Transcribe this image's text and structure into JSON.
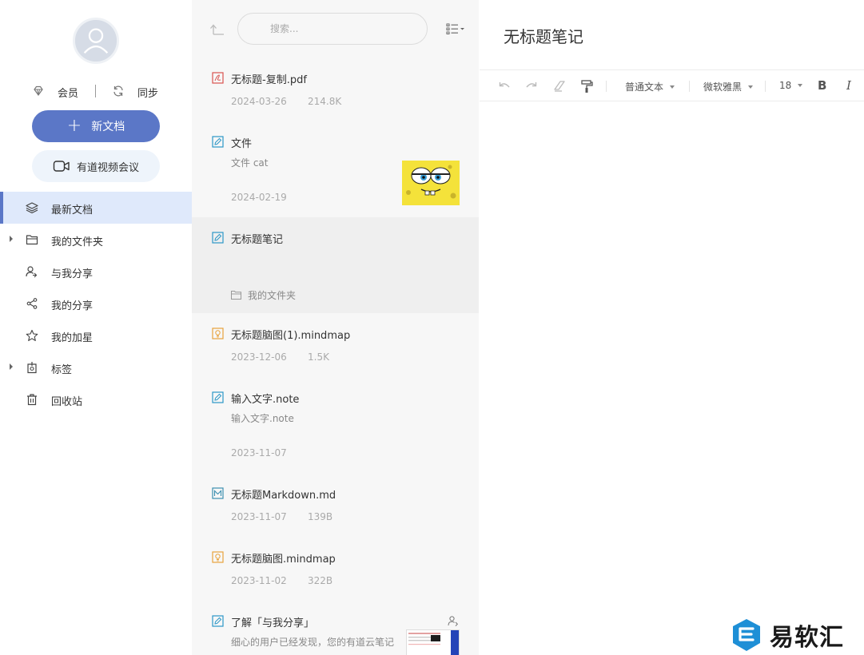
{
  "sidebar": {
    "vip_label": "会员",
    "sync_label": "同步",
    "new_doc_label": "新文档",
    "meeting_label": "有道视频会议",
    "nav": [
      {
        "label": "最新文档",
        "icon": "layers-icon",
        "active": true,
        "expandable": false
      },
      {
        "label": "我的文件夹",
        "icon": "folder-icon",
        "active": false,
        "expandable": true
      },
      {
        "label": "与我分享",
        "icon": "shared-with-me-icon",
        "active": false,
        "expandable": false
      },
      {
        "label": "我的分享",
        "icon": "share-icon",
        "active": false,
        "expandable": false
      },
      {
        "label": "我的加星",
        "icon": "star-icon",
        "active": false,
        "expandable": false
      },
      {
        "label": "标签",
        "icon": "tag-icon",
        "active": false,
        "expandable": true
      },
      {
        "label": "回收站",
        "icon": "trash-icon",
        "active": false,
        "expandable": false
      }
    ]
  },
  "list": {
    "search_placeholder": "搜索...",
    "files": [
      {
        "name": "无标题-复制.pdf",
        "date": "2024-03-26",
        "size": "214.8K",
        "type": "pdf"
      },
      {
        "name": "文件",
        "desc": "文件 cat",
        "date": "2024-02-19",
        "type": "note"
      },
      {
        "name": "无标题笔记",
        "folder": "我的文件夹",
        "type": "note",
        "selected": true
      },
      {
        "name": "无标题脑图(1).mindmap",
        "date": "2023-12-06",
        "size": "1.5K",
        "type": "mindmap"
      },
      {
        "name": "输入文字.note",
        "desc": "输入文字.note",
        "date": "2023-11-07",
        "type": "note"
      },
      {
        "name": "无标题Markdown.md",
        "date": "2023-11-07",
        "size": "139B",
        "type": "markdown"
      },
      {
        "name": "无标题脑图.mindmap",
        "date": "2023-11-02",
        "size": "322B",
        "type": "mindmap"
      },
      {
        "name": "了解「与我分享」",
        "desc": "细心的用户已经发现，您的有道云笔记",
        "type": "note"
      }
    ]
  },
  "editor": {
    "title": "无标题笔记",
    "toolbar": {
      "paragraph_style": "普通文本",
      "font": "微软雅黑",
      "font_size": "18",
      "bold_label": "B",
      "italic_label": "I"
    }
  },
  "watermark": {
    "text": "易软汇"
  },
  "colors": {
    "accent": "#5b77c7",
    "active_bg": "#dfe9fb",
    "list_bg": "#f7f7f7",
    "selected_bg": "#efefef"
  }
}
